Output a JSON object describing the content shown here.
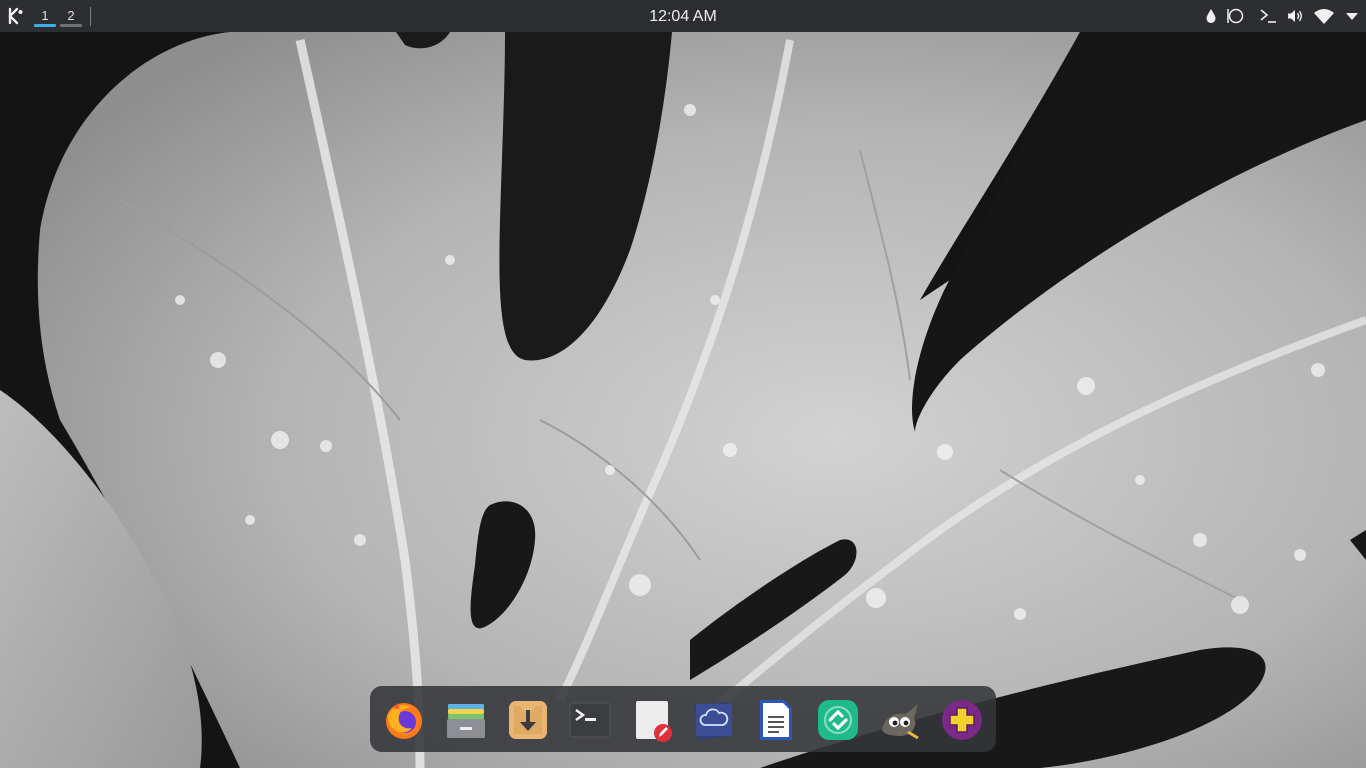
{
  "panel": {
    "launcher_icon": "kde-logo-icon",
    "desktops": [
      {
        "label": "1",
        "active": true
      },
      {
        "label": "2",
        "active": false
      }
    ],
    "clock": "12:04 AM",
    "tray": [
      "color-picker-icon",
      "night-light-icon",
      "terminal-icon",
      "volume-icon",
      "wifi-icon",
      "tray-expand-icon"
    ]
  },
  "dock": {
    "apps": [
      "firefox-icon",
      "file-manager-icon",
      "downloader-icon",
      "terminal-icon",
      "text-editor-icon",
      "cloud-storage-icon",
      "document-writer-icon",
      "sync-app-icon",
      "gimp-icon",
      "app-store-icon"
    ]
  },
  "colors": {
    "panel_bg": "#2c2e32",
    "active_desktop": "#3daee9",
    "inactive_desktop": "#6e7175"
  }
}
